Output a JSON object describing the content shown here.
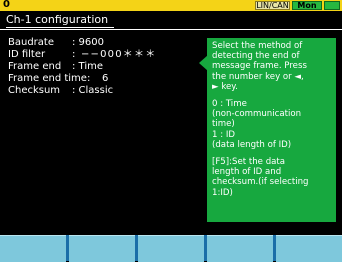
{
  "statusbar": {
    "channel": "0",
    "mode": "LIN/CAN",
    "monitor": "Mon"
  },
  "screen": {
    "title": "Ch-1 configuration"
  },
  "settings": [
    {
      "label": "Baudrate",
      "value": ": 9600"
    },
    {
      "label": "ID filter",
      "value": ": −−000＊＊＊"
    },
    {
      "label": "Frame end",
      "value": ": Time"
    },
    {
      "label": "Frame end time:",
      "value": "6"
    },
    {
      "label": "Checksum",
      "value": ": Classic"
    }
  ],
  "help": {
    "lines": [
      "Select the method of",
      "detecting the end of",
      "message frame. Press",
      "the number key or ◄,",
      "► key."
    ],
    "options": [
      "0 : Time",
      "(non-communication",
      "time)",
      "1 : ID",
      "(data length of ID)"
    ],
    "note": [
      "[F5]:Set the data",
      "length of ID and",
      "checksum.(if selecting",
      "1:ID)"
    ]
  },
  "function_keys": [
    "",
    "",
    "",
    "",
    ""
  ],
  "colors": {
    "statusbar": "#f4d317",
    "help_panel": "#17a83f",
    "function_key": "#7ec8dc"
  }
}
